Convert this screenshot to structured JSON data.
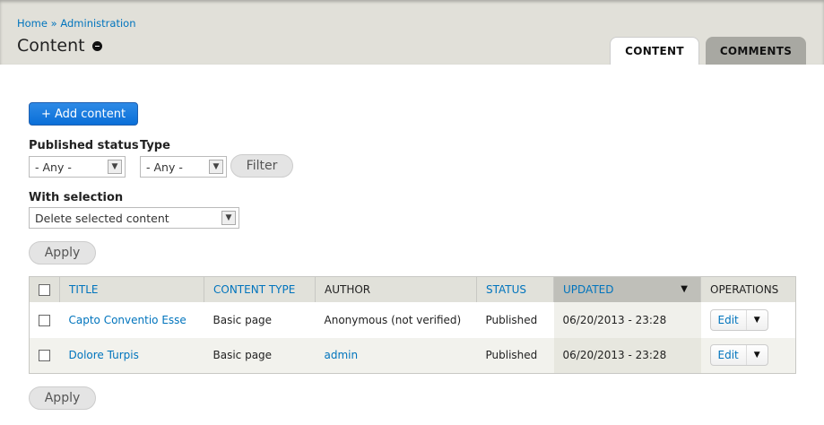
{
  "breadcrumb": {
    "home": "Home",
    "separator": " » ",
    "admin": "Administration"
  },
  "page_title": "Content",
  "tabs": [
    {
      "label": "CONTENT"
    },
    {
      "label": "COMMENTS"
    }
  ],
  "add_button": "+ Add content",
  "filters": {
    "status_label": "Published status",
    "type_label": "Type",
    "status_value": "- Any -",
    "type_value": "- Any -",
    "filter_button": "Filter"
  },
  "bulk": {
    "label": "With selection",
    "value": "Delete selected content",
    "apply": "Apply"
  },
  "table": {
    "headers": [
      "TITLE",
      "CONTENT TYPE",
      "AUTHOR",
      "STATUS",
      "UPDATED",
      "OPERATIONS"
    ],
    "rows": [
      {
        "title": "Capto Conventio Esse",
        "type": "Basic page",
        "author": "Anonymous (not verified)",
        "status": "Published",
        "updated": "06/20/2013 - 23:28",
        "op": "Edit"
      },
      {
        "title": "Dolore Turpis",
        "type": "Basic page",
        "author": "admin",
        "status": "Published",
        "updated": "06/20/2013 - 23:28",
        "op": "Edit"
      }
    ]
  },
  "apply_bottom": "Apply"
}
